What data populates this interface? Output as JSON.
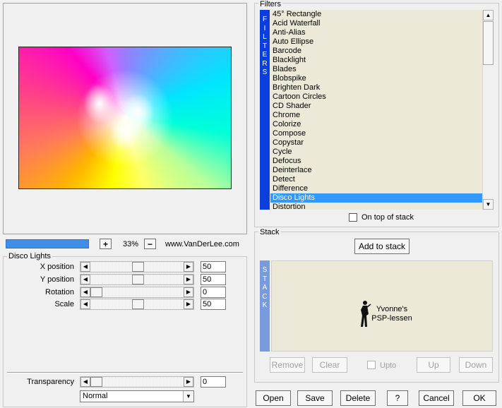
{
  "preview": {
    "zoom": "33%",
    "url": "www.VanDerLee.com",
    "progress": 1.0
  },
  "zoom_controls": {
    "plus_label": "+",
    "minus_label": "−"
  },
  "params": {
    "group_title": "Disco Lights",
    "items": [
      {
        "label": "X position",
        "value": "50",
        "level": 0.5
      },
      {
        "label": "Y position",
        "value": "50",
        "level": 0.5
      },
      {
        "label": "Rotation",
        "value": "0",
        "level": 0.0
      },
      {
        "label": "Scale",
        "value": "50",
        "level": 0.5
      }
    ],
    "transparency": {
      "label": "Transparency",
      "value": "0",
      "level": 0.0
    },
    "blend_mode": "Normal"
  },
  "filters": {
    "title": "Filters",
    "side_label": "FILTERS",
    "items": [
      "45° Rectangle",
      "Acid Waterfall",
      "Anti-Alias",
      "Auto Ellipse",
      "Barcode",
      "Blacklight",
      "Blades",
      "Blobspike",
      "Brighten Dark",
      "Cartoon Circles",
      "CD Shader",
      "Chrome",
      "Colorize",
      "Compose",
      "Copystar",
      "Cycle",
      "Defocus",
      "Deinterlace",
      "Detect",
      "Difference",
      "Disco Lights",
      "Distortion"
    ],
    "selected": "Disco Lights",
    "on_top_label": "On top of stack"
  },
  "stack": {
    "title": "Stack",
    "side_label": "STACK",
    "add_label": "Add to stack",
    "logo_line1": "Yvonne's",
    "logo_line2": "PSP-lessen",
    "remove_label": "Remove",
    "clear_label": "Clear",
    "upto_label": "Upto",
    "up_label": "Up",
    "down_label": "Down"
  },
  "bottom_buttons": {
    "open": "Open",
    "save": "Save",
    "delete": "Delete",
    "help": "?",
    "cancel": "Cancel",
    "ok": "OK"
  },
  "colors": {
    "accent_bar": "#0a3fdb",
    "stack_bar": "#7a9ade",
    "selection": "#3399ff",
    "list_bg": "#ece9d8"
  }
}
